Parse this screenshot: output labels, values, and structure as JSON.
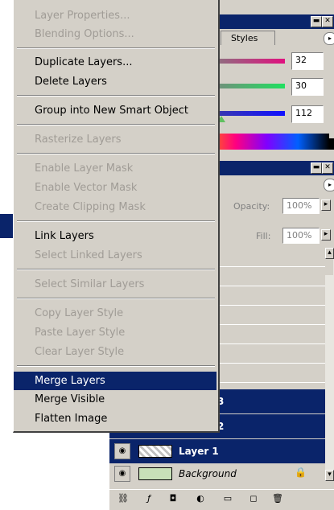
{
  "menu": {
    "items": [
      {
        "label": "Layer Properties...",
        "enabled": false
      },
      {
        "label": "Blending Options...",
        "enabled": false
      },
      {
        "label": "Duplicate Layers...",
        "enabled": true
      },
      {
        "label": "Delete Layers",
        "enabled": true
      },
      {
        "label": "Group into New Smart Object",
        "enabled": true
      },
      {
        "label": "Rasterize Layers",
        "enabled": false
      },
      {
        "label": "Enable Layer Mask",
        "enabled": false
      },
      {
        "label": "Enable Vector Mask",
        "enabled": false
      },
      {
        "label": "Create Clipping Mask",
        "enabled": false
      },
      {
        "label": "Link Layers",
        "enabled": true
      },
      {
        "label": "Select Linked Layers",
        "enabled": false
      },
      {
        "label": "Select Similar Layers",
        "enabled": false
      },
      {
        "label": "Copy Layer Style",
        "enabled": false
      },
      {
        "label": "Paste Layer Style",
        "enabled": false
      },
      {
        "label": "Clear Layer Style",
        "enabled": false
      },
      {
        "label": "Merge Layers",
        "enabled": true,
        "highlighted": true
      },
      {
        "label": "Merge Visible",
        "enabled": true
      },
      {
        "label": "Flatten Image",
        "enabled": true
      }
    ]
  },
  "color_panel": {
    "tab_label": "Styles",
    "r_value": "32",
    "g_value": "30",
    "b_value": "112"
  },
  "layers_panel": {
    "opacity_label": "Opacity:",
    "opacity_value": "100%",
    "fill_label": "Fill:",
    "fill_value": "100%",
    "layers": [
      {
        "name": "3",
        "selected": true
      },
      {
        "name": "2",
        "selected": true
      },
      {
        "name": "Layer 1",
        "selected": true
      },
      {
        "name": "Background",
        "selected": false,
        "locked": true
      }
    ]
  },
  "colors": {
    "selection": "#0a246a",
    "panel_bg": "#d4d0c8"
  }
}
